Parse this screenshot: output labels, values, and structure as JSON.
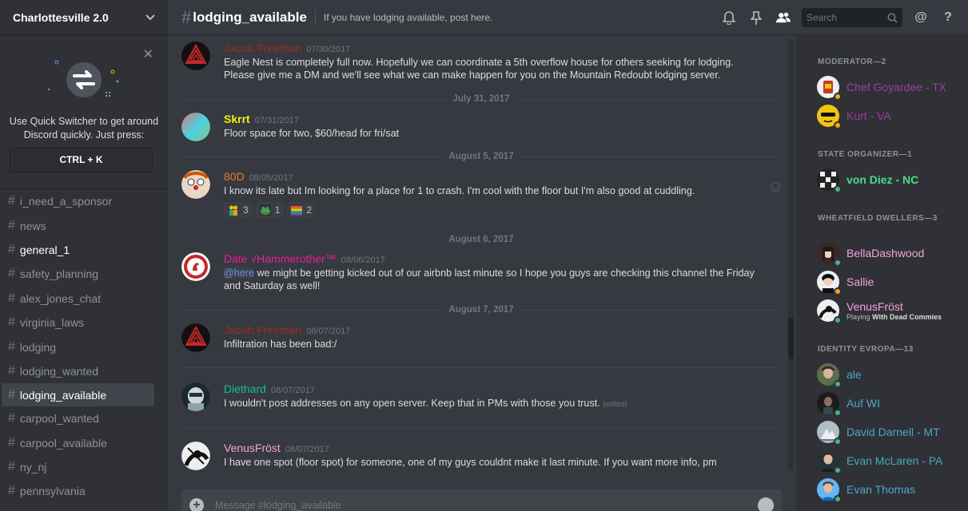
{
  "server": {
    "name": "Charlottesville 2.0"
  },
  "quick_switcher": {
    "text": "Use Quick Switcher to get around Discord quickly. Just press:",
    "shortcut": "CTRL + K"
  },
  "channels": [
    {
      "name": "i_need_a_sponsor",
      "state": "normal"
    },
    {
      "name": "news",
      "state": "normal"
    },
    {
      "name": "general_1",
      "state": "unread"
    },
    {
      "name": "safety_planning",
      "state": "normal"
    },
    {
      "name": "alex_jones_chat",
      "state": "normal"
    },
    {
      "name": "virginia_laws",
      "state": "normal"
    },
    {
      "name": "lodging",
      "state": "normal"
    },
    {
      "name": "lodging_wanted",
      "state": "normal"
    },
    {
      "name": "lodging_available",
      "state": "active"
    },
    {
      "name": "carpool_wanted",
      "state": "normal"
    },
    {
      "name": "carpool_available",
      "state": "normal"
    },
    {
      "name": "ny_nj",
      "state": "normal"
    },
    {
      "name": "pennsylvania",
      "state": "normal"
    }
  ],
  "header": {
    "channel": "lodging_available",
    "topic": "If you have lodging available, post here.",
    "search_placeholder": "Search"
  },
  "messages": [
    {
      "author": "Jacob Freeman",
      "color": "#992d22",
      "ts": "07/30/2017",
      "lines": [
        "Eagle Nest is completely full now. Hopefully we can coordinate a 5th overflow house for others seeking for lodging.",
        "Please give me a DM and we'll see what we can make happen for you on the Mountain Redoubt lodging server."
      ]
    },
    {
      "date": "July 31, 2017"
    },
    {
      "author": "Skrrt",
      "color": "#f1f10f",
      "ts": "07/31/2017",
      "lines": [
        "Floor space for two, $60/head for fri/sat"
      ]
    },
    {
      "date": "August 5, 2017"
    },
    {
      "author": "80D",
      "color": "#e67e22",
      "ts": "08/05/2017",
      "lines": [
        "I know its late but Im looking for a place for 1 to crash. I'm cool with the floor but I'm also good at cuddling."
      ],
      "reactions": [
        "3",
        "1",
        "2"
      ]
    },
    {
      "date": "August 6, 2017"
    },
    {
      "author": "Date √Hammerother™",
      "color": "#e91e9c",
      "ts": "08/06/2017",
      "mention": "@here",
      "lines": [
        " we might be getting kicked out of our airbnb last minute so I hope you guys are checking this channel the Friday",
        "and Saturday as well!"
      ]
    },
    {
      "date": "August 7, 2017"
    },
    {
      "author": "Jacob Freeman",
      "color": "#992d22",
      "ts": "08/07/2017",
      "lines": [
        "Infiltration has been bad:/"
      ]
    },
    {
      "author": "Diethard",
      "color": "#1abc9c",
      "ts": "08/07/2017",
      "lines": [
        "I wouldn't post addresses on any open server. Keep that in PMs with those you trust."
      ],
      "edited": "(edited)"
    },
    {
      "author": "VenusFröst",
      "color": "#f5a3d8",
      "ts": "08/07/2017",
      "lines": [
        "I have one spot (floor spot) for someone, one of my guys couldnt make it last minute.  If you want more info, pm"
      ]
    }
  ],
  "composer": {
    "placeholder": "Message #lodging_available"
  },
  "member_groups": [
    {
      "title": "MODERATOR—2",
      "members": [
        {
          "name": "Chef Goyardee - TX",
          "color": "#9b3ca3",
          "status": "#faa61a"
        },
        {
          "name": "Kurt - VA",
          "color": "#9b3ca3",
          "status": "#faa61a"
        }
      ]
    },
    {
      "title": "STATE ORGANIZER—1",
      "members": [
        {
          "name": "von Diez - NC",
          "color": "#4bdc8a",
          "status": "#43b581"
        }
      ]
    },
    {
      "title": "WHEATFIELD DWELLERS—3",
      "members": [
        {
          "name": "BellaDashwood",
          "color": "#f5a3d8",
          "status": "#43b581"
        },
        {
          "name": "Sallie",
          "color": "#f5a3d8",
          "status": "#faa61a"
        },
        {
          "name": "VenusFröst",
          "color": "#f5a3d8",
          "status": "#43b581",
          "game": "Playing",
          "game_name": "With Dead Commies"
        }
      ]
    },
    {
      "title": "IDENTITY EVROPA—13",
      "members": [
        {
          "name": "ale",
          "color": "#4aa8c4",
          "status": "#43b581"
        },
        {
          "name": "Auf WI",
          "color": "#4aa8c4",
          "status": "#43b581"
        },
        {
          "name": "David Darnell - MT",
          "color": "#4aa8c4",
          "status": "#43b581"
        },
        {
          "name": "Evan McLaren - PA",
          "color": "#4aa8c4",
          "status": "#43b581"
        },
        {
          "name": "Evan Thomas",
          "color": "#4aa8c4",
          "status": "#43b581"
        }
      ]
    }
  ]
}
